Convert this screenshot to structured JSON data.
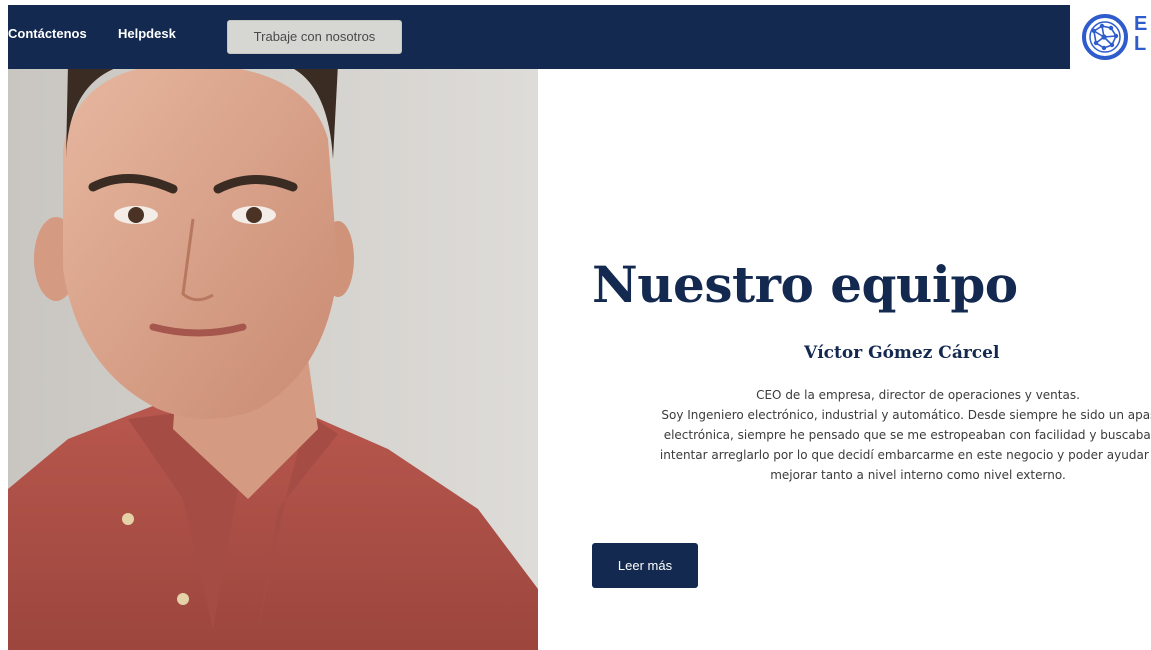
{
  "nav": {
    "contact": "Contáctenos",
    "helpdesk": "Helpdesk",
    "careers": "Trabaje con nosotros"
  },
  "logo": {
    "icon": "globe-network-icon",
    "line1": "E",
    "line2": "L"
  },
  "photo": {
    "alt": "person-portrait"
  },
  "section": {
    "title": "Nuestro equipo",
    "member_name": "Víctor Gómez Cárcel",
    "bio_lines": [
      "CEO de la empresa, director de operaciones y ventas.",
      "Soy Ingeniero electrónico, industrial y automático. Desde siempre he sido un apasion",
      "electrónica, siempre he pensado que se me estropeaban con facilidad y buscaba vía",
      "intentar arreglarlo por lo que decidí embarcarme en este negocio y poder ayudar a er",
      "mejorar tanto a nivel interno como nivel externo."
    ],
    "cta_label": "Leer más"
  },
  "colors": {
    "navy": "#13294f",
    "logo_blue": "#2f5ccc",
    "button_grey": "#d6d7d2"
  }
}
